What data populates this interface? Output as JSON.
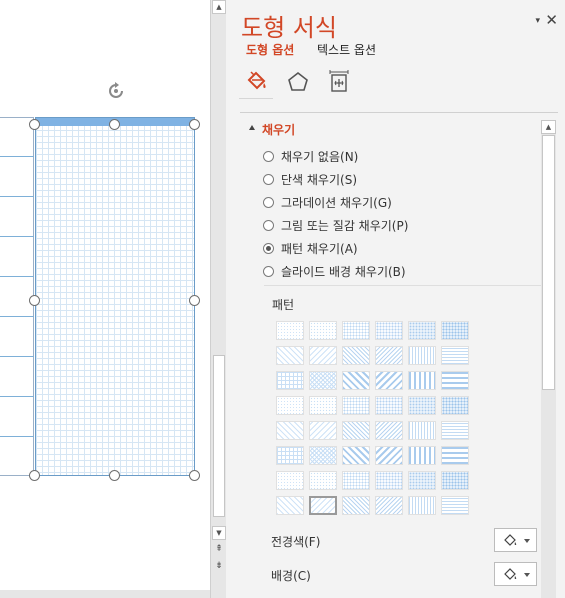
{
  "pane": {
    "title": "도형 서식",
    "options_glyph": "▾",
    "close_glyph": "✕",
    "tabs": [
      {
        "label": "도형 옵션",
        "active": true
      },
      {
        "label": "텍스트 옵션",
        "active": false
      }
    ],
    "icons": [
      "fill-line-icon",
      "effects-icon",
      "size-properties-icon"
    ]
  },
  "fill_section": {
    "header": "채우기",
    "options": [
      {
        "label": "채우기 없음(N)",
        "checked": false
      },
      {
        "label": "단색 채우기(S)",
        "checked": false
      },
      {
        "label": "그라데이션 채우기(G)",
        "checked": false
      },
      {
        "label": "그림 또는 질감 채우기(P)",
        "checked": false
      },
      {
        "label": "패턴 채우기(A)",
        "checked": true
      },
      {
        "label": "슬라이드 배경 채우기(B)",
        "checked": false
      }
    ],
    "pattern_label": "패턴",
    "pattern_rows": 8,
    "pattern_cols": 6,
    "selected_pattern_index": 43,
    "foreground_label": "전경색(F)",
    "background_label": "배경(C)"
  },
  "colors": {
    "accent": "#d24726",
    "pane_bg": "#f3f3f3",
    "workspace_bg": "#e6e6e6",
    "selection_blue": "#7fb2e3"
  }
}
